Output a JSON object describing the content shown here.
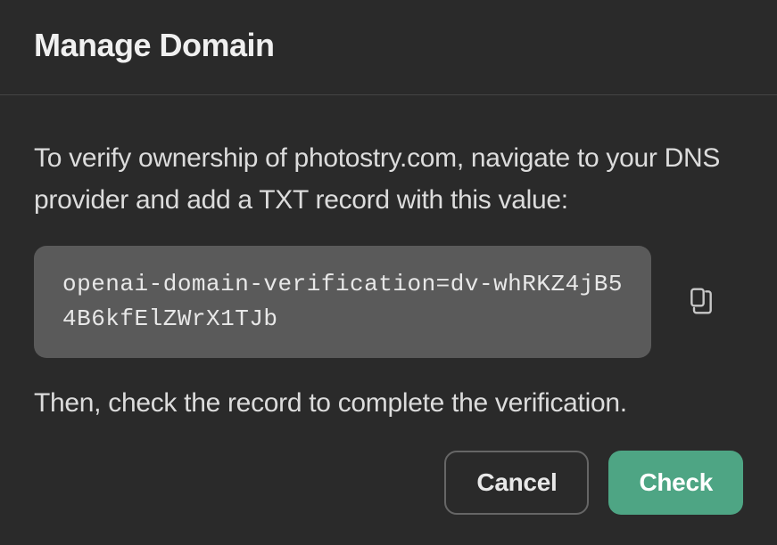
{
  "header": {
    "title": "Manage Domain"
  },
  "body": {
    "instruction": "To verify ownership of photostry.com, navigate to your DNS provider and add a TXT record with this value:",
    "txt_record": "openai-domain-verification=dv-whRKZ4jB54B6kfElZWrX1TJb",
    "followup": "Then, check the record to complete the verification."
  },
  "buttons": {
    "cancel": "Cancel",
    "check": "Check"
  },
  "colors": {
    "accent": "#4ea584",
    "background": "#2a2a2a",
    "code_bg": "#5a5a5a"
  }
}
